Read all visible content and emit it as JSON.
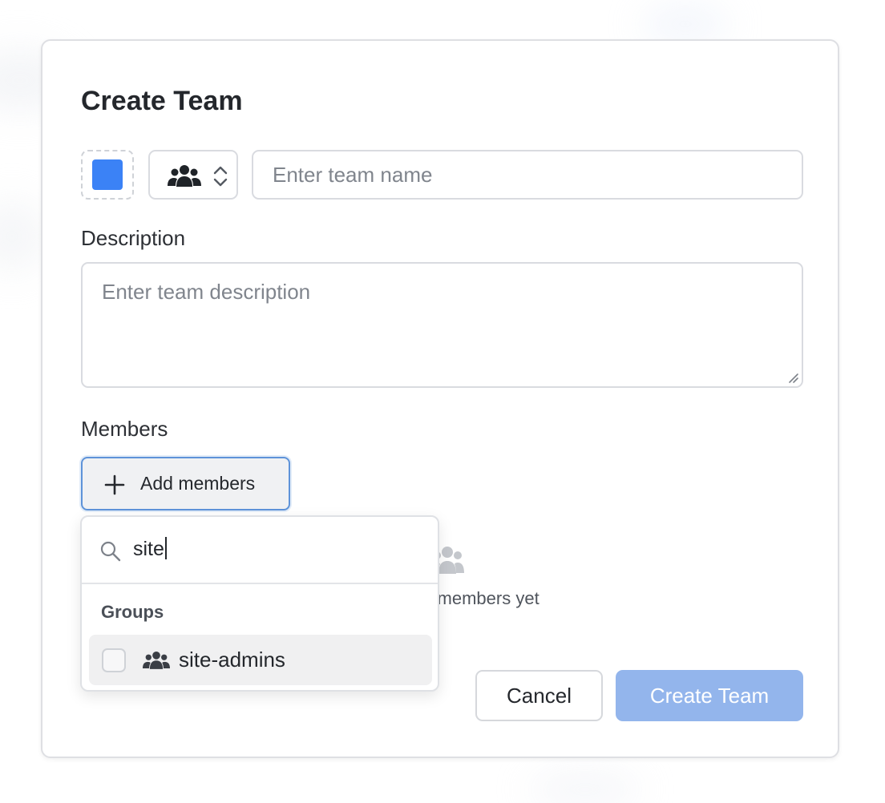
{
  "dialog": {
    "title": "Create Team",
    "color_swatch": "#3b82f6",
    "icon_select": {
      "icon": "team-icon"
    },
    "name_input": {
      "value": "",
      "placeholder": "Enter team name"
    },
    "description": {
      "label": "Description",
      "value": "",
      "placeholder": "Enter team description"
    },
    "members": {
      "label": "Members",
      "add_button_label": "Add members",
      "empty_text": "No members yet"
    },
    "footer": {
      "cancel_label": "Cancel",
      "create_label": "Create Team"
    }
  },
  "member_picker": {
    "search_value": "site",
    "group_heading": "Groups",
    "groups": [
      {
        "label": "site-admins",
        "checked": false
      }
    ]
  },
  "colors": {
    "accent": "#3b82f6",
    "create_button_disabled": "#93b5ec",
    "focus_ring": "#5e93d9"
  }
}
